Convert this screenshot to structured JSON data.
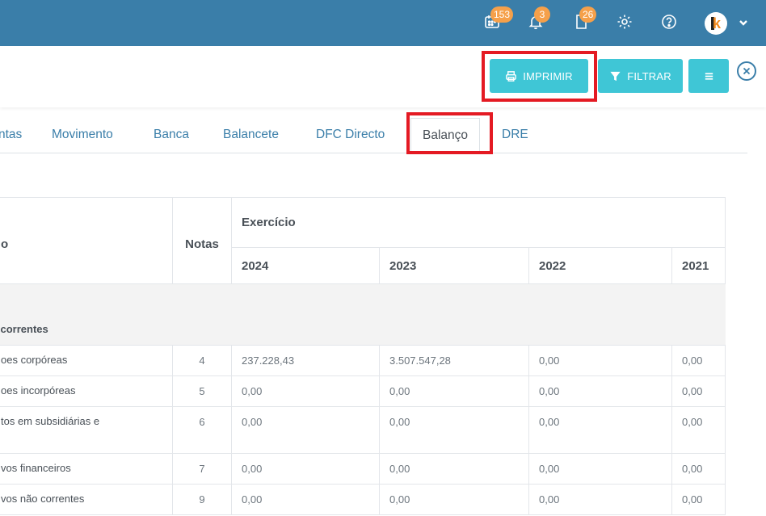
{
  "topbar": {
    "calendar_badge": "153",
    "bell_badge": "3",
    "doc_badge": "26",
    "icons": [
      "calendar-icon",
      "bell-icon",
      "document-icon",
      "gear-icon",
      "help-icon",
      "chevron-down-icon"
    ]
  },
  "toolbar": {
    "print_label": "IMPRIMIR",
    "filter_label": "FILTRAR"
  },
  "tabs": [
    {
      "label": "ntas"
    },
    {
      "label": "Movimento"
    },
    {
      "label": "Banca"
    },
    {
      "label": "Balancete"
    },
    {
      "label": "DFC Directo"
    },
    {
      "label": "Balanço",
      "active": true
    },
    {
      "label": "DRE"
    }
  ],
  "table": {
    "col_description": "o",
    "col_notes": "Notas",
    "col_exercise": "Exercício",
    "years": [
      "2024",
      "2023",
      "2022",
      "2021"
    ],
    "group_label": "correntes",
    "rows": [
      {
        "label": "oes corpóreas",
        "nota": "4",
        "values": [
          "237.228,43",
          "3.507.547,28",
          "0,00",
          "0,00"
        ]
      },
      {
        "label": "oes incorpóreas",
        "nota": "5",
        "values": [
          "0,00",
          "0,00",
          "0,00",
          "0,00"
        ]
      },
      {
        "label": "tos em subsidiárias e",
        "nota": "6",
        "values": [
          "0,00",
          "0,00",
          "0,00",
          "0,00"
        ]
      },
      {
        "label": "vos financeiros",
        "nota": "7",
        "values": [
          "0,00",
          "0,00",
          "0,00",
          "0,00"
        ]
      },
      {
        "label": "vos não correntes",
        "nota": "9",
        "values": [
          "0,00",
          "0,00",
          "0,00",
          "0,00"
        ]
      }
    ]
  },
  "colors": {
    "topbar": "#3a7ea9",
    "button": "#3fc6d6",
    "highlight": "#e41a23",
    "badge": "#f5a04a"
  }
}
